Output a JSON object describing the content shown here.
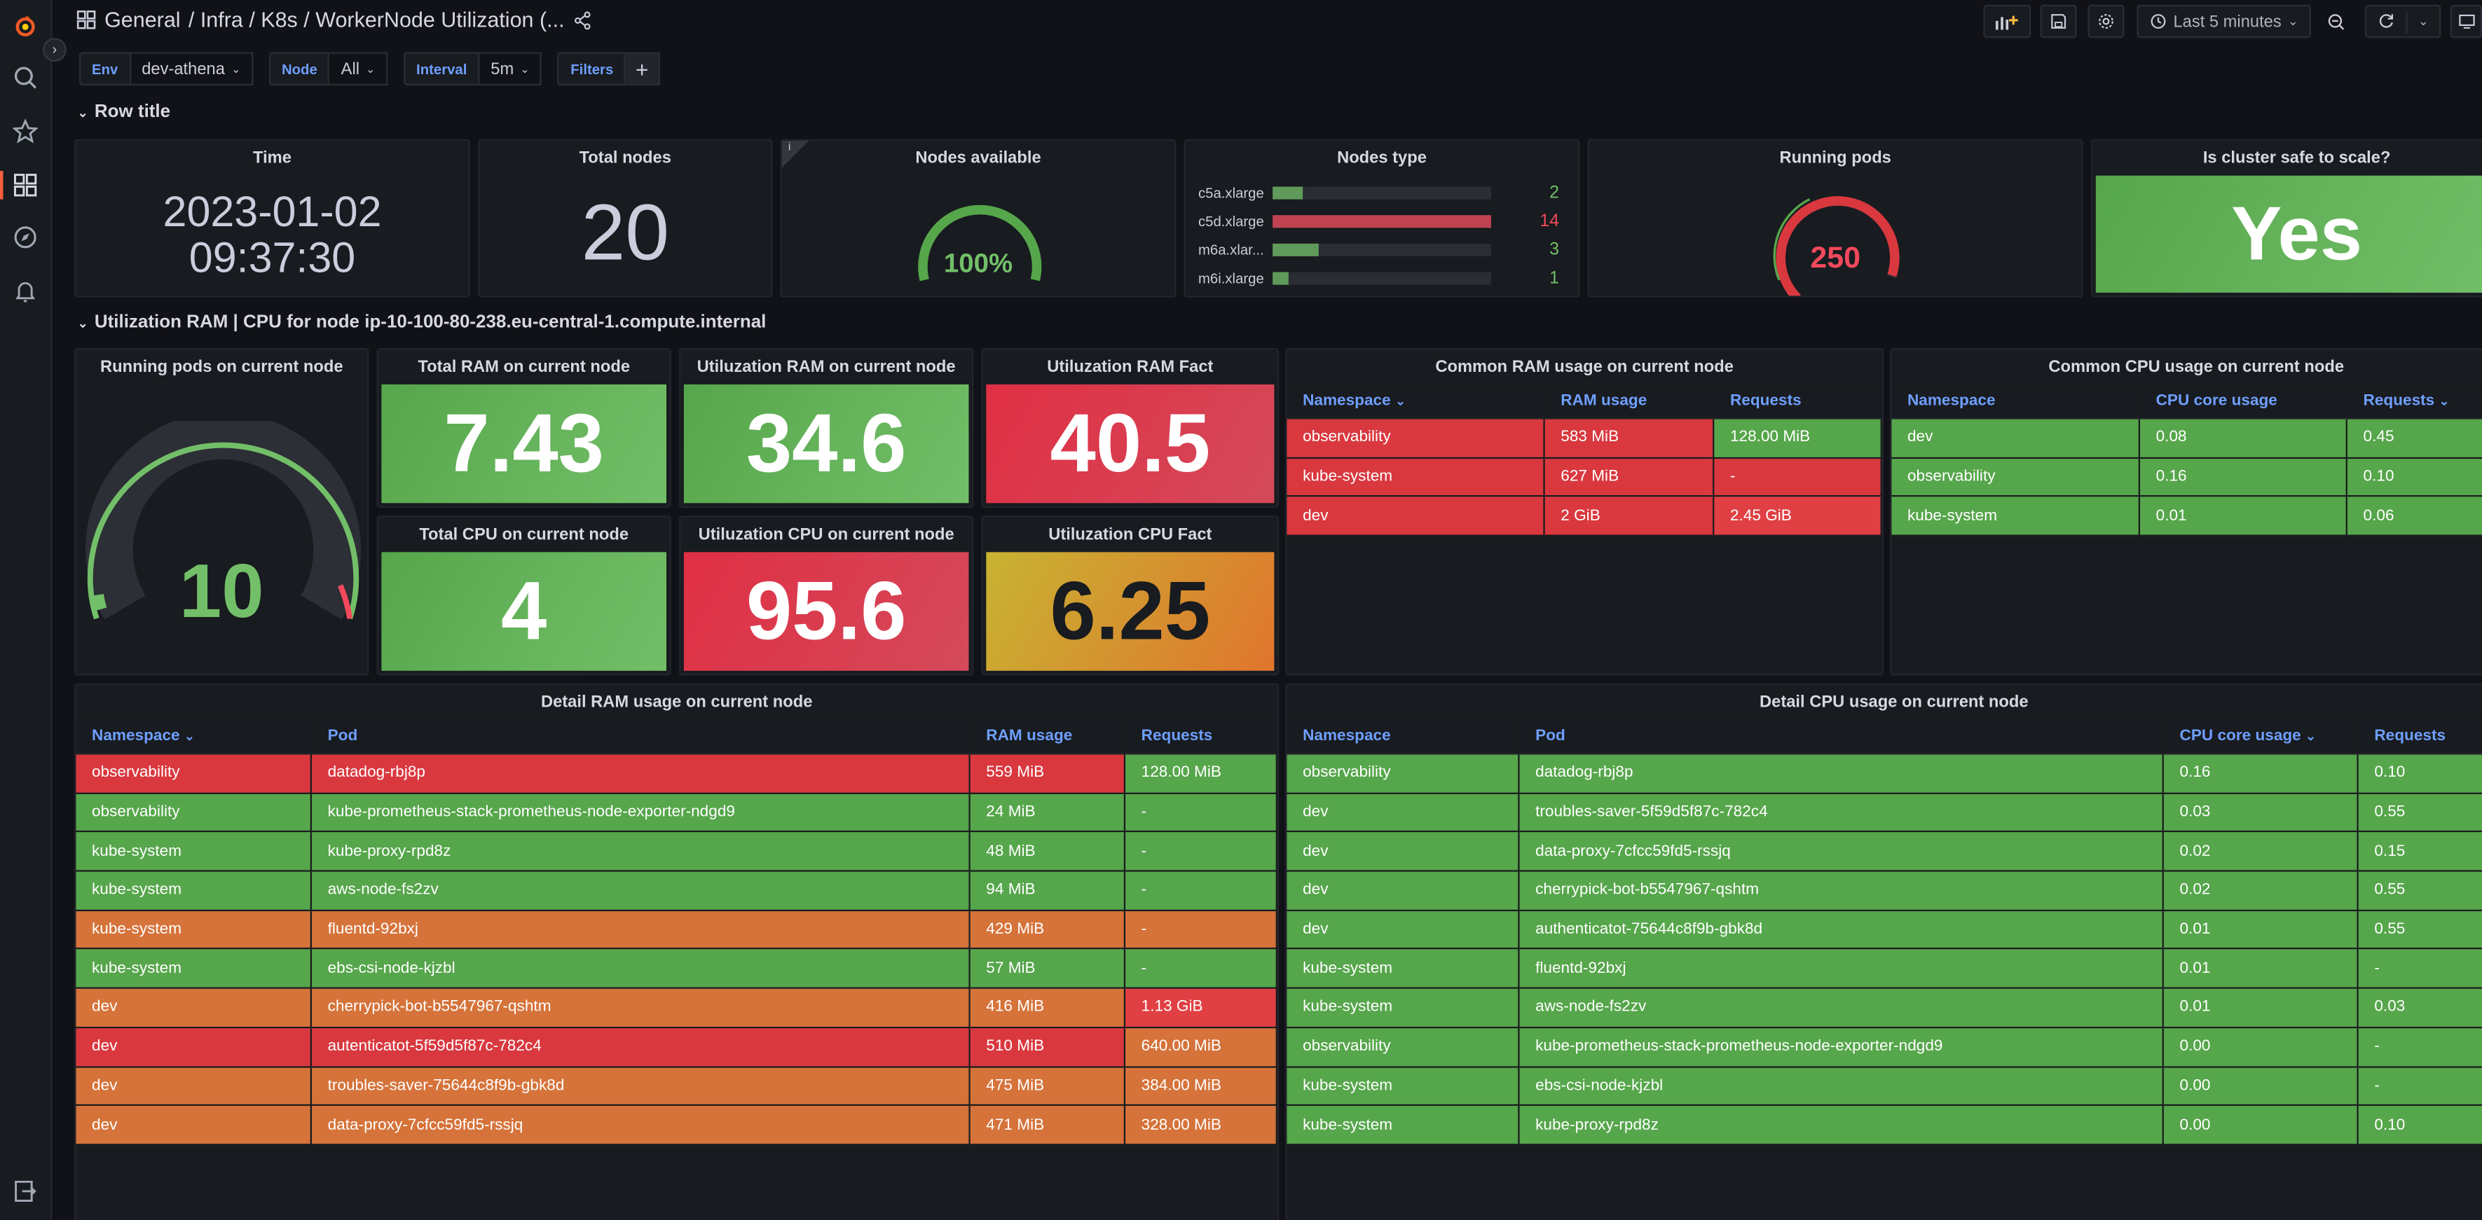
{
  "breadcrumb": {
    "root": "General",
    "path": "/ Infra / K8s / WorkerNode Utilization (..."
  },
  "toolbar": {
    "time_range": "Last 5 minutes"
  },
  "variables": [
    {
      "label": "Env",
      "value": "dev-athena"
    },
    {
      "label": "Node",
      "value": "All"
    },
    {
      "label": "Interval",
      "value": "5m"
    },
    {
      "label": "Filters",
      "value": ""
    }
  ],
  "rows": {
    "row1": "Row title",
    "row2": "Utilization RAM | CPU for node ip-10-100-80-238.eu-central-1.compute.internal"
  },
  "panels": {
    "time": {
      "title": "Time",
      "line1": "2023-01-02",
      "line2": "09:37:30"
    },
    "total_nodes": {
      "title": "Total nodes",
      "value": "20"
    },
    "nodes_available": {
      "title": "Nodes available",
      "value": "100%",
      "percent": 100
    },
    "nodes_type": {
      "title": "Nodes type",
      "items": [
        {
          "label": "c5a.xlarge",
          "value": "2",
          "fraction": 0.14,
          "color": "#73bf69"
        },
        {
          "label": "c5d.xlarge",
          "value": "14",
          "fraction": 1.0,
          "color": "#f2495c"
        },
        {
          "label": "m6a.xlar...",
          "value": "3",
          "fraction": 0.21,
          "color": "#73bf69"
        },
        {
          "label": "m6i.xlarge",
          "value": "1",
          "fraction": 0.07,
          "color": "#73bf69"
        }
      ]
    },
    "running_pods": {
      "title": "Running pods",
      "value": "250",
      "fraction": 0.9
    },
    "cluster_safe": {
      "title": "Is cluster safe to scale?",
      "value": "Yes"
    },
    "pods_on_node": {
      "title": "Running pods on current node",
      "value": "10",
      "fraction": 0.93
    },
    "total_ram": {
      "title": "Total RAM on current node",
      "value": "7.43"
    },
    "util_ram": {
      "title": "Utiluzation RAM on current node",
      "value": "34.6"
    },
    "util_ram_fact": {
      "title": "Utiluzation RAM Fact",
      "value": "40.5"
    },
    "total_cpu": {
      "title": "Total CPU on current node",
      "value": "4"
    },
    "util_cpu": {
      "title": "Utiluzation CPU on current node",
      "value": "95.6"
    },
    "util_cpu_fact": {
      "title": "Utiluzation CPU Fact",
      "value": "6.25"
    }
  },
  "common_ram": {
    "title": "Common RAM usage on current node",
    "headers": [
      "Namespace",
      "RAM usage",
      "Requests"
    ],
    "rows": [
      [
        "observability",
        "583 MiB",
        "128.00 MiB"
      ],
      [
        "kube-system",
        "627 MiB",
        "-"
      ],
      [
        "dev",
        "2 GiB",
        "2.45 GiB"
      ]
    ]
  },
  "common_cpu": {
    "title": "Common CPU usage on current node",
    "headers": [
      "Namespace",
      "CPU core usage",
      "Requests"
    ],
    "rows": [
      [
        "dev",
        "0.08",
        "0.45"
      ],
      [
        "observability",
        "0.16",
        "0.10"
      ],
      [
        "kube-system",
        "0.01",
        "0.06"
      ]
    ]
  },
  "detail_ram": {
    "title": "Detail RAM usage on current node",
    "headers": [
      "Namespace",
      "Pod",
      "RAM usage",
      "Requests"
    ],
    "rows": [
      [
        "observability",
        "datadog-rbj8p",
        "559 MiB",
        "128.00 MiB"
      ],
      [
        "observability",
        "kube-prometheus-stack-prometheus-node-exporter-ndgd9",
        "24 MiB",
        "-"
      ],
      [
        "kube-system",
        "kube-proxy-rpd8z",
        "48 MiB",
        "-"
      ],
      [
        "kube-system",
        "aws-node-fs2zv",
        "94 MiB",
        "-"
      ],
      [
        "kube-system",
        "fluentd-92bxj",
        "429 MiB",
        "-"
      ],
      [
        "kube-system",
        "ebs-csi-node-kjzbl",
        "57 MiB",
        "-"
      ],
      [
        "dev",
        "cherrypick-bot-b5547967-qshtm",
        "416 MiB",
        "1.13 GiB"
      ],
      [
        "dev",
        "autenticatot-5f59d5f87c-782c4",
        "510 MiB",
        "640.00 MiB"
      ],
      [
        "dev",
        "troubles-saver-75644c8f9b-gbk8d",
        "475 MiB",
        "384.00 MiB"
      ],
      [
        "dev",
        "data-proxy-7cfcc59fd5-rssjq",
        "471 MiB",
        "328.00 MiB"
      ]
    ]
  },
  "detail_cpu": {
    "title": "Detail CPU usage on current node",
    "headers": [
      "Namespace",
      "Pod",
      "CPU core usage",
      "Requests"
    ],
    "rows": [
      [
        "observability",
        "datadog-rbj8p",
        "0.16",
        "0.10"
      ],
      [
        "dev",
        "troubles-saver-5f59d5f87c-782c4",
        "0.03",
        "0.55"
      ],
      [
        "dev",
        "data-proxy-7cfcc59fd5-rssjq",
        "0.02",
        "0.15"
      ],
      [
        "dev",
        "cherrypick-bot-b5547967-qshtm",
        "0.02",
        "0.55"
      ],
      [
        "dev",
        "authenticatot-75644c8f9b-gbk8d",
        "0.01",
        "0.55"
      ],
      [
        "kube-system",
        "fluentd-92bxj",
        "0.01",
        "-"
      ],
      [
        "kube-system",
        "aws-node-fs2zv",
        "0.01",
        "0.03"
      ],
      [
        "observability",
        "kube-prometheus-stack-prometheus-node-exporter-ndgd9",
        "0.00",
        "-"
      ],
      [
        "kube-system",
        "ebs-csi-node-kjzbl",
        "0.00",
        "-"
      ],
      [
        "kube-system",
        "kube-proxy-rpd8z",
        "0.00",
        "0.10"
      ]
    ]
  }
}
